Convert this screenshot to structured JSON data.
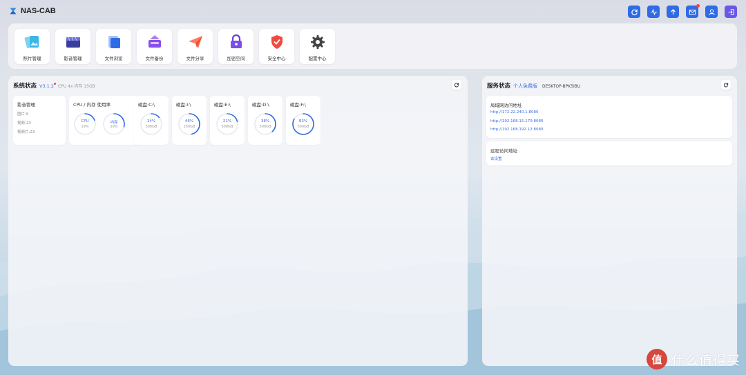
{
  "brand": {
    "name": "NAS-CAB"
  },
  "top_actions": [
    {
      "icon": "refresh-icon"
    },
    {
      "icon": "activity-icon"
    },
    {
      "icon": "upload-icon"
    },
    {
      "icon": "mail-icon",
      "badge": true
    },
    {
      "icon": "user-icon"
    },
    {
      "icon": "logout-icon"
    }
  ],
  "apps": [
    {
      "label": "照片管理",
      "icon": "photos-icon"
    },
    {
      "label": "影音管理",
      "icon": "media-icon"
    },
    {
      "label": "文件浏览",
      "icon": "files-icon"
    },
    {
      "label": "文件备份",
      "icon": "backup-icon"
    },
    {
      "label": "文件分享",
      "icon": "share-icon"
    },
    {
      "label": "加密空间",
      "icon": "lock-icon"
    },
    {
      "label": "安全中心",
      "icon": "shield-icon"
    },
    {
      "label": "配置中心",
      "icon": "gear-icon"
    }
  ],
  "system_status": {
    "title": "系统状态",
    "version": "V3.1.2",
    "spec": "CPU 4x 内存 15GB",
    "media_card": {
      "title": "影音管理",
      "lines": [
        "图片:0",
        "视频:23",
        "视频片:23"
      ]
    },
    "usage_card": {
      "title": "CPU / 内存 使用率",
      "gauges": [
        {
          "label": "CPU",
          "value": "19%",
          "fraction": 0.19
        },
        {
          "label": "内存",
          "value": "29%",
          "fraction": 0.29
        }
      ]
    },
    "disks": [
      {
        "title": "磁盘:C:\\",
        "percent": "14%",
        "size": "500GB",
        "fraction": 0.14
      },
      {
        "title": "磁盘:I:\\",
        "percent": "46%",
        "size": "250GB",
        "fraction": 0.46
      },
      {
        "title": "磁盘:E:\\",
        "percent": "21%",
        "size": "500GB",
        "fraction": 0.21
      },
      {
        "title": "磁盘:D:\\",
        "percent": "38%",
        "size": "500GB",
        "fraction": 0.38
      },
      {
        "title": "磁盘:F:\\",
        "percent": "83%",
        "size": "500GB",
        "fraction": 0.83
      }
    ]
  },
  "service_status": {
    "title": "服务状态",
    "edition": "个人免费版",
    "host": "DESKTOP-BPK5IBU",
    "lan": {
      "title": "局域网访问地址",
      "links": [
        "http://172.22.240.1:8080",
        "http://192.168.15.170:8080",
        "http://192.168.192.12:8080"
      ]
    },
    "remote": {
      "title": "远程访问地址",
      "action": "去设置"
    }
  },
  "colors": {
    "accent": "#2f6be5",
    "accent_alt": "#6b56e6",
    "badge": "#f0463c",
    "track": "#e6e9ef"
  },
  "watermark": {
    "text": "什么值得买",
    "badge": "值"
  }
}
